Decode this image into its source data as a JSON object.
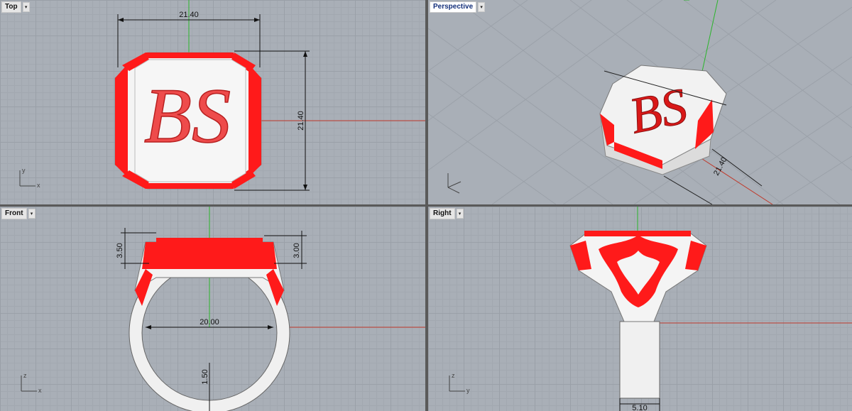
{
  "viewports": {
    "top": {
      "label": "Top",
      "dim_width": "21.40",
      "dim_height": "21.40",
      "axis_x": "x",
      "axis_y": "y",
      "monogram": "BS"
    },
    "perspective": {
      "label": "Perspective",
      "dim": "21.40",
      "monogram": "BS"
    },
    "front": {
      "label": "Front",
      "dim_left": "3.50",
      "dim_right": "3.00",
      "dim_inner": "20.00",
      "dim_thick": "1.50",
      "axis_x": "x",
      "axis_z": "z"
    },
    "right": {
      "label": "Right",
      "dim_bottom": "5.10",
      "axis_y": "y",
      "axis_z": "z"
    }
  },
  "colors": {
    "grid_bg": "#a9afb7",
    "model_red": "#ff1a1a",
    "model_white": "#f4f4f4",
    "axis_red": "#c0392b",
    "axis_green": "#2bb52b"
  }
}
